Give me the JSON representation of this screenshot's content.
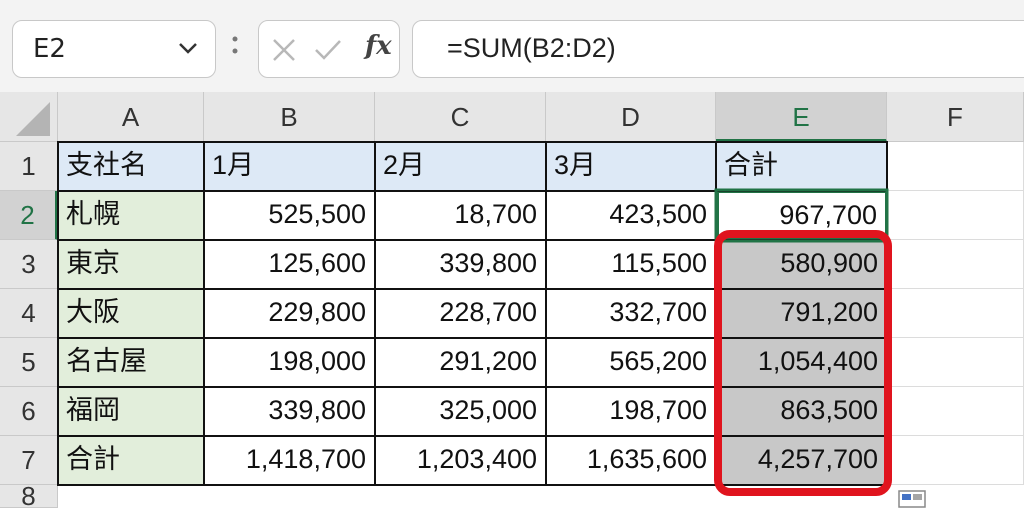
{
  "formula_bar": {
    "name_box": "E2",
    "fx_label": "fx",
    "formula": "=SUM(B2:D2)"
  },
  "columns": [
    "A",
    "B",
    "C",
    "D",
    "E",
    "F"
  ],
  "rows": [
    "1",
    "2",
    "3",
    "4",
    "5",
    "6",
    "7",
    "8"
  ],
  "sheet": {
    "header": [
      "支社名",
      "1月",
      "2月",
      "3月",
      "合計"
    ],
    "data": [
      [
        "札幌",
        "525,500",
        "18,700",
        "423,500",
        "967,700"
      ],
      [
        "東京",
        "125,600",
        "339,800",
        "115,500",
        "580,900"
      ],
      [
        "大阪",
        "229,800",
        "228,700",
        "332,700",
        "791,200"
      ],
      [
        "名古屋",
        "198,000",
        "291,200",
        "565,200",
        "1,054,400"
      ],
      [
        "福岡",
        "339,800",
        "325,000",
        "198,700",
        "863,500"
      ],
      [
        "合計",
        "1,418,700",
        "1,203,400",
        "1,635,600",
        "4,257,700"
      ]
    ]
  },
  "selected_cell": "E2",
  "colors": {
    "accent_green": "#217346",
    "highlight_red": "#e0141e",
    "header_blue": "#dde9f6",
    "name_green": "#e2eedb",
    "total_gray": "#c8c8c8"
  }
}
